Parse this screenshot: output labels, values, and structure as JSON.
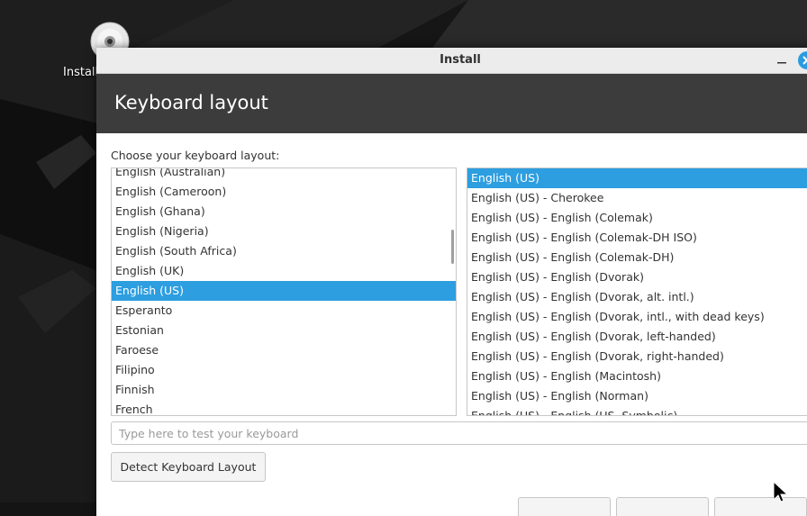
{
  "desktop": {
    "icon_label": "Install",
    "icon": "disc-icon"
  },
  "window": {
    "title": "Install",
    "controls": [
      "minimize-icon",
      "close-icon"
    ],
    "accent_color": "#2d9ee0"
  },
  "page": {
    "title": "Keyboard layout",
    "instruction": "Choose your keyboard layout:"
  },
  "layouts": {
    "selected": "English (US)",
    "items": [
      "English (Australian)",
      "English (Cameroon)",
      "English (Ghana)",
      "English (Nigeria)",
      "English (South Africa)",
      "English (UK)",
      "English (US)",
      "Esperanto",
      "Estonian",
      "Faroese",
      "Filipino",
      "Finnish",
      "French"
    ]
  },
  "variants": {
    "selected": "English (US)",
    "items": [
      "English (US)",
      "English (US) - Cherokee",
      "English (US) - English (Colemak)",
      "English (US) - English (Colemak-DH ISO)",
      "English (US) - English (Colemak-DH)",
      "English (US) - English (Dvorak)",
      "English (US) - English (Dvorak, alt. intl.)",
      "English (US) - English (Dvorak, intl., with dead keys)",
      "English (US) - English (Dvorak, left-handed)",
      "English (US) - English (Dvorak, right-handed)",
      "English (US) - English (Macintosh)",
      "English (US) - English (Norman)",
      "English (US) - English (US, Symbolic)"
    ]
  },
  "test_input": {
    "placeholder": "Type here to test your keyboard",
    "value": ""
  },
  "detect_button": {
    "label": "Detect Keyboard Layout"
  }
}
